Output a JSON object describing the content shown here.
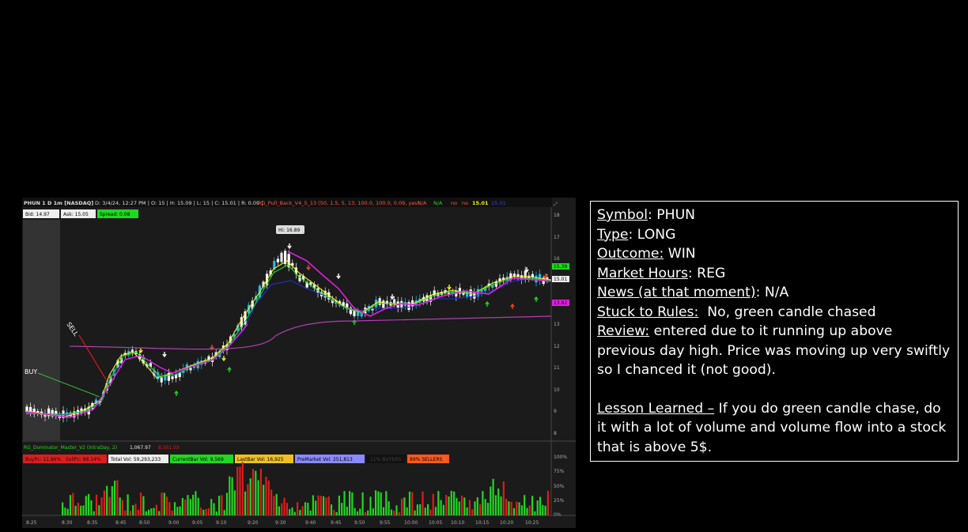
{
  "chart": {
    "header": {
      "symbol": "PHUN 1 D 1m [NASDAQ]",
      "info": "D: 3/4/24, 12:27 PM | O: 15 | H: 15.09 | L: 15 | C: 15.01 | R: 0.09 |",
      "study": "RG_Pull_Back_V4_5_13 (50, 1.5, 5, 13, 100.0, 100.0, 0.09, yes)",
      "na": "N/A",
      "no": "no",
      "last": "15.01",
      "extra": "15.01"
    },
    "quote": {
      "bid": "Bid: 14.97",
      "ask": "Ask: 15.05",
      "spread": "Spread: 0.08"
    },
    "hi_label": "Hi: 16.89",
    "buy_label": "BUY",
    "sell_label": "SELL",
    "price_axis": [
      "18",
      "17",
      "16",
      "15",
      "14",
      "13",
      "12",
      "11",
      "10",
      "9",
      "8"
    ],
    "price_tags": {
      "top": "15.39",
      "mid": "15.01",
      "low": "13.92"
    },
    "lower_title": "RG_Dominator_Master_V2 (IntraDay, 2)",
    "lower_val1": "1,067.97",
    "lower_val2": "8,501.03",
    "stats": {
      "buy": "BuyPc: 11.86%",
      "sell": "SellPc: 88.14%",
      "total": "Total Vol: 59,293,233",
      "current": "CurrentBar Vol: 9,569",
      "lastbar": "LastBar Vol: 16,925",
      "premarket": "PreMarket Vol: 251,813",
      "buyers": "11% BUYERS",
      "sellers": "89% SELLERS"
    },
    "pct_axis": [
      "100%",
      "75%",
      "50%",
      "25%",
      "0%"
    ],
    "time_axis": [
      "8:25",
      "8:30",
      "8:35",
      "8:45",
      "8:50",
      "9:00",
      "9:05",
      "9:10",
      "9:20",
      "9:30",
      "9:40",
      "9:45",
      "9:50",
      "9:55",
      "10:00",
      "10:05",
      "10:10",
      "10:15",
      "10:20",
      "10:25"
    ]
  },
  "colors": {
    "green": "#20d820",
    "red": "#e01c1c",
    "magenta": "#e020e0",
    "yellow": "#f0f020",
    "blue": "#2030d0",
    "purple": "#b040b0"
  },
  "notes": {
    "symbol_label": "Symbol",
    "symbol_value": ": PHUN",
    "type_label": "Type",
    "type_value": ": LONG",
    "outcome_label": "Outcome:",
    "outcome_value": " WIN",
    "hours_label": "Market Hours",
    "hours_value": ": REG",
    "news_label": "News (at that moment)",
    "news_value": ": N/A",
    "rules_label": "Stuck to Rules:",
    "rules_value": "  No, green candle chased",
    "review_label": "Review:",
    "review_value": "  entered due to it running up above previous day high.  Price was moving up very swiftly so I chanced it (not good).",
    "lesson_label": "Lesson Learned –",
    "lesson_value": "  If you do green candle chase, do it with a lot of volume and volume flow into a stock that is above 5$."
  }
}
